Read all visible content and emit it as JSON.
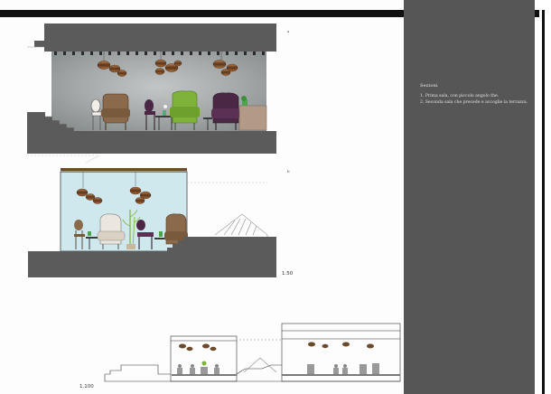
{
  "panel": {
    "title": "Sezioni",
    "items": [
      "1. Prima sala, con piccolo angolo the.",
      "2. Seconda sala che precede e accoglie la terrazza."
    ]
  },
  "scales": {
    "upper": "1.50",
    "lower": "1.100"
  },
  "markers": {
    "one": "a",
    "two": "b"
  },
  "colors": {
    "wall_gray": "#5b5b5b",
    "sky_blue": "#cfe8ee",
    "concrete": "#a9adad",
    "chair_purple": "#4a2745",
    "chair_green": "#7fb23a",
    "chair_brown": "#8a6a4a",
    "lamp_bronze": "#7a4a2a",
    "panel_gray": "#565656"
  }
}
